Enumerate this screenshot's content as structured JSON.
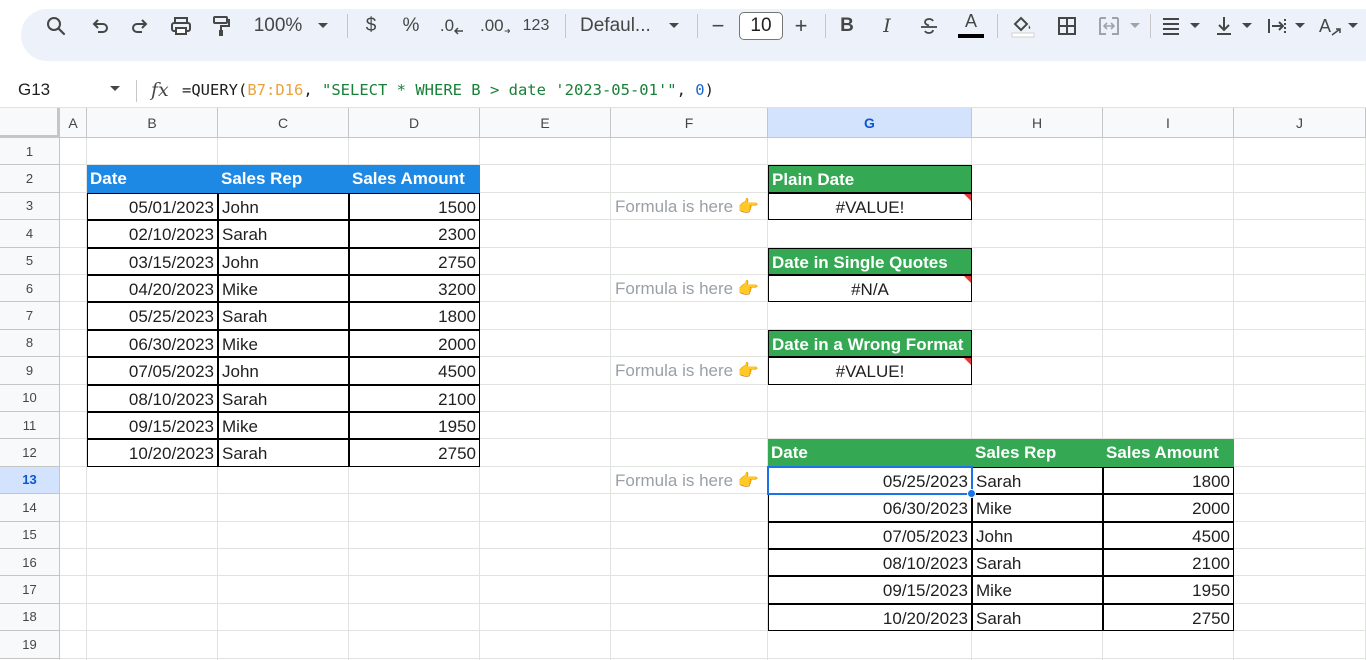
{
  "toolbar": {
    "zoom": "100%",
    "currency": "$",
    "percent": "%",
    "decrease_decimals": ".0",
    "increase_decimals": ".00",
    "number_format": "123",
    "font_name": "Defaul...",
    "font_size": "10",
    "minus": "−",
    "plus": "+",
    "bold": "B",
    "italic": "I",
    "text_color_letter": "A",
    "font_color_letter": "A"
  },
  "formula_bar": {
    "cell_ref": "G13",
    "fx": "fx",
    "f_prefix": "=QUERY(",
    "f_range": "B7:D16",
    "f_sep1": ", ",
    "f_query": "\"SELECT * WHERE B > date '2023-05-01'\"",
    "f_sep2": ", ",
    "f_headers": "0",
    "f_close": ")"
  },
  "columns": [
    "A",
    "B",
    "C",
    "D",
    "E",
    "F",
    "G",
    "H",
    "I",
    "J"
  ],
  "rows": [
    "1",
    "2",
    "3",
    "4",
    "5",
    "6",
    "7",
    "8",
    "9",
    "10",
    "11",
    "12",
    "13",
    "14",
    "15",
    "16",
    "17",
    "18",
    "19"
  ],
  "selected_cell": {
    "column": "G",
    "row": "13"
  },
  "source_table": {
    "headers": [
      "Date",
      "Sales Rep",
      "Sales Amount"
    ],
    "rows": [
      [
        "05/01/2023",
        "John",
        "1500"
      ],
      [
        "02/10/2023",
        "Sarah",
        "2300"
      ],
      [
        "03/15/2023",
        "John",
        "2750"
      ],
      [
        "04/20/2023",
        "Mike",
        "3200"
      ],
      [
        "05/25/2023",
        "Sarah",
        "1800"
      ],
      [
        "06/30/2023",
        "Mike",
        "2000"
      ],
      [
        "07/05/2023",
        "John",
        "4500"
      ],
      [
        "08/10/2023",
        "Sarah",
        "2100"
      ],
      [
        "09/15/2023",
        "Mike",
        "1950"
      ],
      [
        "10/20/2023",
        "Sarah",
        "2750"
      ]
    ]
  },
  "notes": {
    "formula_here": "Formula is here 👉"
  },
  "examples": [
    {
      "title": "Plain Date",
      "result": "#VALUE!"
    },
    {
      "title": "Date in Single Quotes",
      "result": "#N/A"
    },
    {
      "title": "Date in a Wrong Format",
      "result": "#VALUE!"
    }
  ],
  "result_table": {
    "headers": [
      "Date",
      "Sales Rep",
      "Sales Amount"
    ],
    "rows": [
      [
        "05/25/2023",
        "Sarah",
        "1800"
      ],
      [
        "06/30/2023",
        "Mike",
        "2000"
      ],
      [
        "07/05/2023",
        "John",
        "4500"
      ],
      [
        "08/10/2023",
        "Sarah",
        "2100"
      ],
      [
        "09/15/2023",
        "Mike",
        "1950"
      ],
      [
        "10/20/2023",
        "Sarah",
        "2750"
      ]
    ]
  },
  "colors": {
    "header_blue": "#1e88e5",
    "header_green": "#34a853",
    "error_marker": "#e53935",
    "selection": "#1a73e8"
  }
}
